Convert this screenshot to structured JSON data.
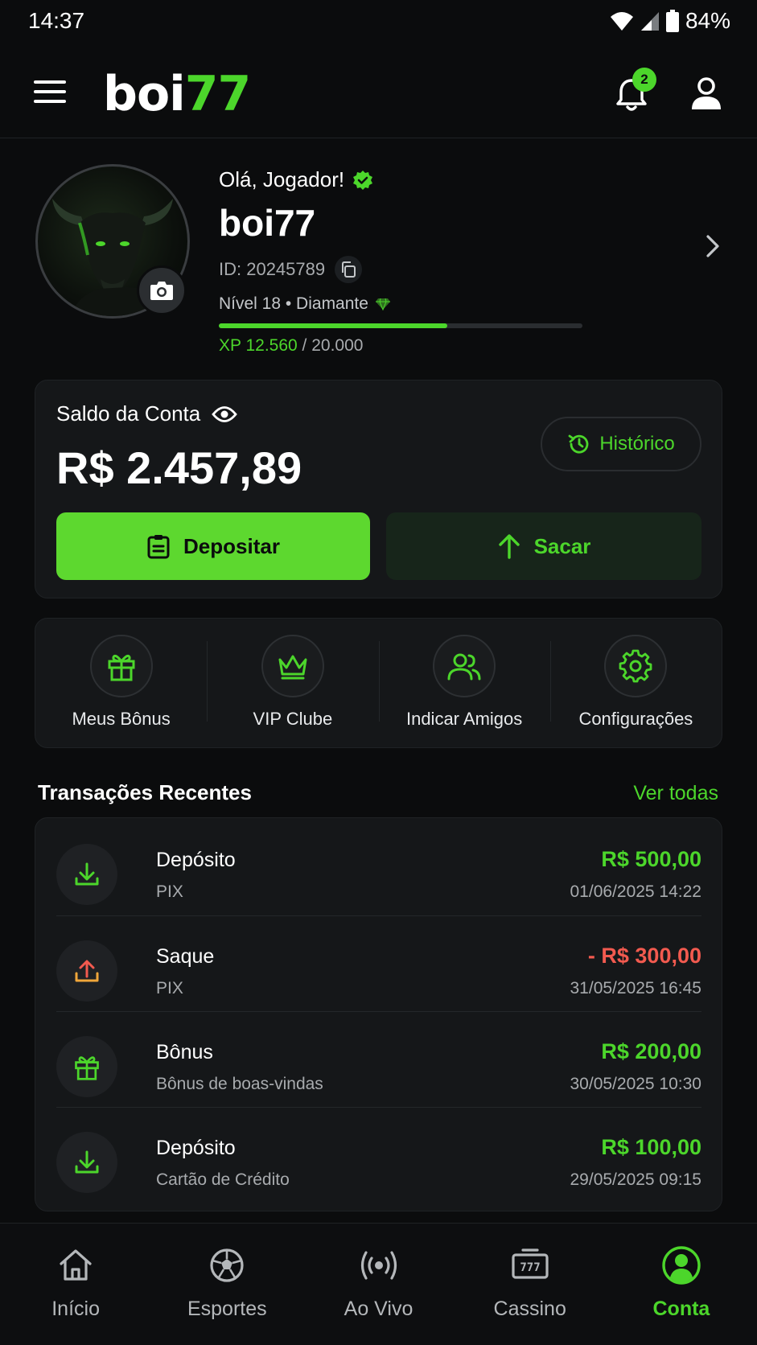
{
  "status_bar": {
    "time": "14:37",
    "battery": "84%"
  },
  "header": {
    "logo_part1": "boi",
    "logo_part2": "77",
    "notification_count": "2",
    "accent_color": "#4cd62b"
  },
  "profile": {
    "greeting": "Olá, Jogador!",
    "username": "boi77",
    "id_text": "ID: 20245789",
    "level_text": "Nível 18 • Diamante",
    "xp_current": "XP 12.560",
    "xp_total": " / 20.000",
    "xp_progress": 0.628
  },
  "balance": {
    "label": "Saldo da Conta",
    "amount": "R$ 2.457,89",
    "history_label": "Histórico",
    "deposit_label": "Depositar",
    "withdraw_label": "Sacar"
  },
  "shortcuts": [
    {
      "label": "Meus Bônus",
      "icon": "gift-icon"
    },
    {
      "label": "VIP Clube",
      "icon": "crown-icon"
    },
    {
      "label": "Indicar Amigos",
      "icon": "users-icon"
    },
    {
      "label": "Configurações",
      "icon": "gear-icon"
    }
  ],
  "transactions": {
    "title": "Transações Recentes",
    "see_all": "Ver todas",
    "items": [
      {
        "name": "Depósito",
        "method": "PIX",
        "amount": "R$ 500,00",
        "date": "01/06/2025 14:22",
        "type": "positive",
        "icon": "download-icon"
      },
      {
        "name": "Saque",
        "method": "PIX",
        "amount": "- R$ 300,00",
        "date": "31/05/2025 16:45",
        "type": "negative",
        "icon": "upload-icon"
      },
      {
        "name": "Bônus",
        "method": "Bônus de boas-vindas",
        "amount": "R$ 200,00",
        "date": "30/05/2025 10:30",
        "type": "positive",
        "icon": "gift-icon"
      },
      {
        "name": "Depósito",
        "method": "Cartão de Crédito",
        "amount": "R$ 100,00",
        "date": "29/05/2025 09:15",
        "type": "positive",
        "icon": "download-icon"
      }
    ]
  },
  "bottom_nav": [
    {
      "label": "Início",
      "icon": "home-icon"
    },
    {
      "label": "Esportes",
      "icon": "soccer-ball-icon"
    },
    {
      "label": "Ao Vivo",
      "icon": "live-broadcast-icon"
    },
    {
      "label": "Cassino",
      "icon": "slot-machine-icon"
    },
    {
      "label": "Conta",
      "icon": "account-icon",
      "active": true
    }
  ]
}
